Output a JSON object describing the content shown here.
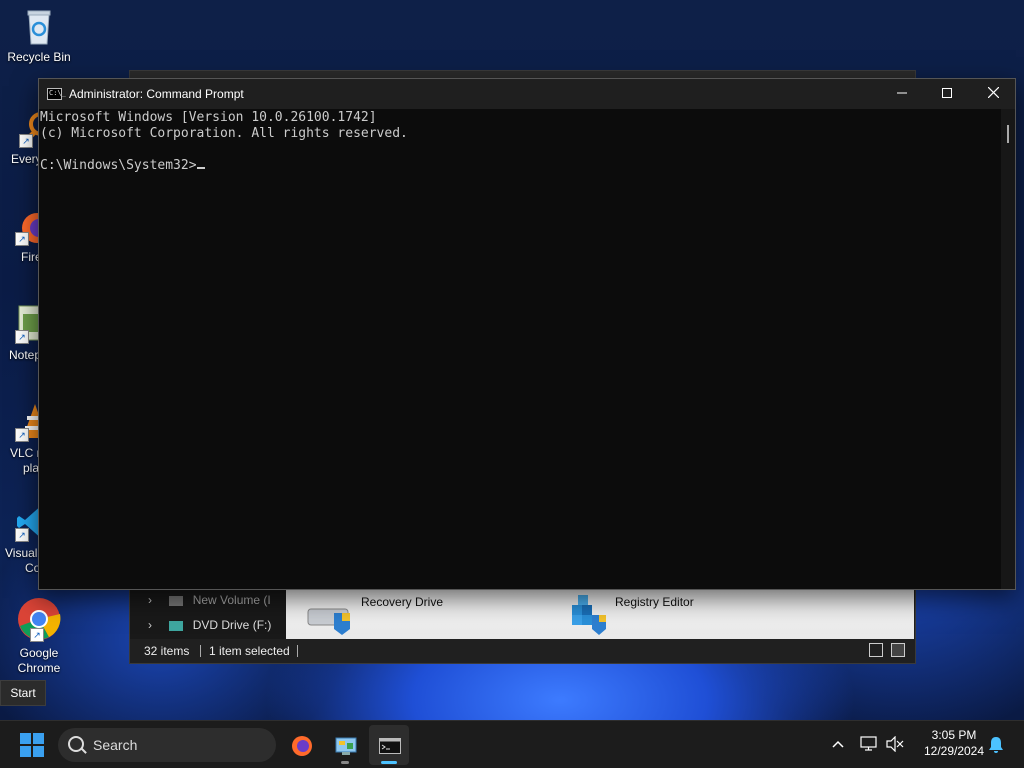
{
  "desktop": {
    "icons": [
      {
        "label": "Recycle Bin",
        "icon": "recycle-bin-icon"
      },
      {
        "label": "Every",
        "icon": "everything-search-icon"
      },
      {
        "label": "Fire",
        "icon": "firefox-icon"
      },
      {
        "label": "Notep",
        "icon": "notepad-icon"
      },
      {
        "label": "VLC m",
        "label2": "pla",
        "icon": "vlc-icon"
      },
      {
        "label": "Visual",
        "label2": "Co",
        "icon": "vscode-icon"
      },
      {
        "label": "Google",
        "label2": "Chrome",
        "icon": "chrome-icon"
      }
    ]
  },
  "explorer": {
    "nav": [
      {
        "label": "New Volume (I",
        "icon": "drive-icon"
      },
      {
        "label": "DVD Drive (F:)",
        "icon": "dvd-drive-icon"
      }
    ],
    "items": [
      {
        "label": "Recovery Drive",
        "icon": "recovery-drive-icon"
      },
      {
        "label": "Registry Editor",
        "icon": "registry-editor-icon"
      }
    ],
    "status": {
      "count": "32 items",
      "selected": "1 item selected"
    }
  },
  "cmd": {
    "title": "Administrator: Command Prompt",
    "lines": [
      "Microsoft Windows [Version 10.0.26100.1742]",
      "(c) Microsoft Corporation. All rights reserved.",
      "",
      "C:\\Windows\\System32>"
    ]
  },
  "tooltip": {
    "label": "Start"
  },
  "taskbar": {
    "search_label": "Search",
    "apps": [
      {
        "name": "firefox",
        "icon": "firefox-icon"
      },
      {
        "name": "control-panel",
        "icon": "control-panel-icon"
      },
      {
        "name": "command-prompt",
        "icon": "command-prompt-icon"
      }
    ],
    "time": "3:05 PM",
    "date": "12/29/2024"
  },
  "colors": {
    "accent": "#4cc2ff",
    "console_bg": "#0c0c0c",
    "console_fg": "#cccccc",
    "taskbar_bg": "#1c1c1c"
  }
}
